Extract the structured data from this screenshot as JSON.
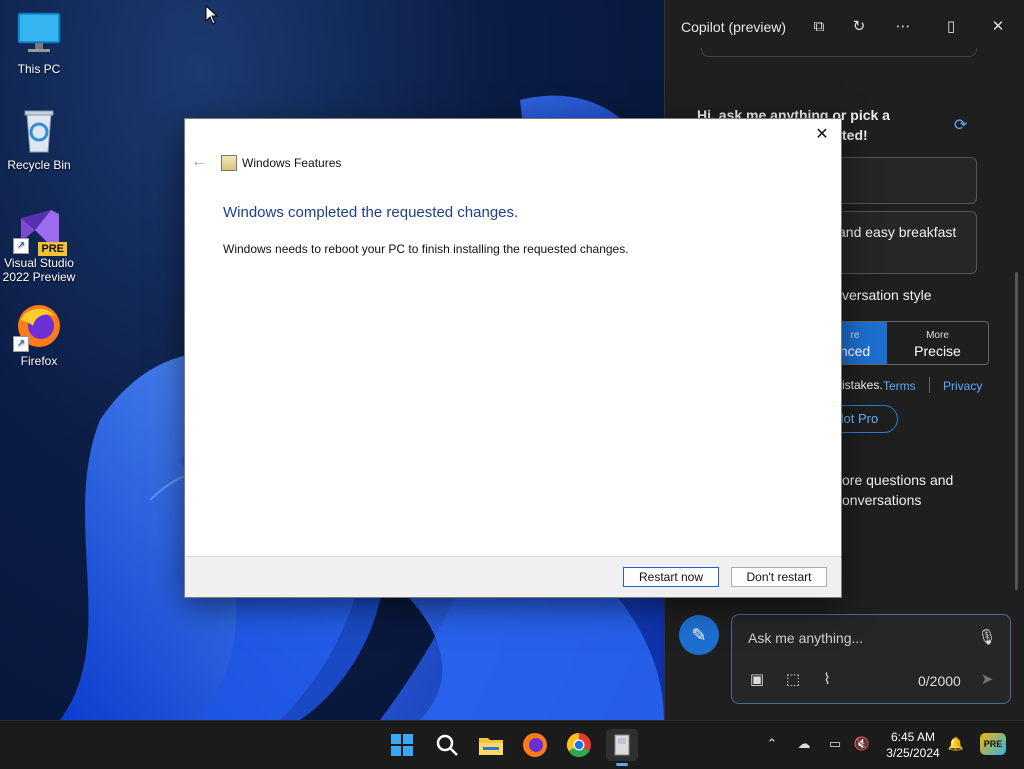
{
  "desktop": {
    "icons": [
      {
        "label": "This PC"
      },
      {
        "label": "Recycle Bin"
      },
      {
        "label": "Visual Studio 2022 Preview",
        "badge": "PRE"
      },
      {
        "label": "Firefox"
      }
    ]
  },
  "dialog": {
    "title": "Windows Features",
    "heading": "Windows completed the requested changes.",
    "message": "Windows needs to reboot your PC to finish installing the requested changes.",
    "restart_label": "Restart now",
    "dont_restart_label": "Don't restart",
    "close_glyph": "✕",
    "back_glyph": "←"
  },
  "copilot": {
    "title": "Copilot (preview)",
    "greeting_line1": "Hi, ask me anything or pick a",
    "greeting_line2": "ted!",
    "suggestion2": "and easy breakfast",
    "conversation_style": "versation style",
    "style_left_small": "re",
    "style_left_big": "nced",
    "style_right_small": "More",
    "style_right_big": "Precise",
    "mistakes_text": "istakes.",
    "terms": "Terms",
    "privacy": "Privacy",
    "pro_label": "ilot Pro",
    "more_line1": "ore questions and",
    "more_line2": "onversations",
    "input_placeholder": "Ask me anything...",
    "char_count": "0/2000"
  },
  "taskbar": {
    "time": "6:45 AM",
    "date": "3/25/2024",
    "apps": [
      "start",
      "search",
      "file-explorer",
      "firefox",
      "chrome",
      "windows-features"
    ]
  },
  "colors": {
    "accent": "#1d6fd1",
    "dialog_heading": "#1e3f8c",
    "link": "#5aa9ff"
  }
}
